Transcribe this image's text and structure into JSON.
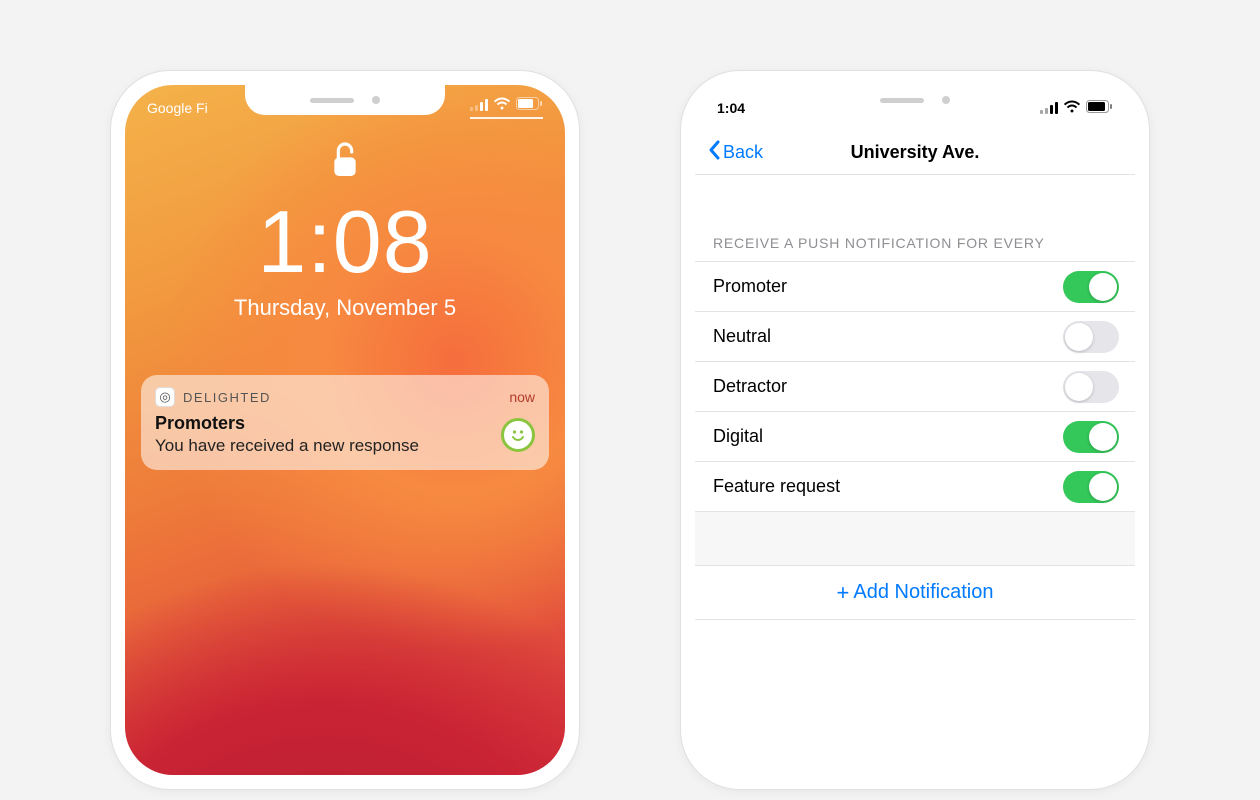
{
  "left": {
    "carrier": "Google Fi",
    "time": "1:08",
    "date": "Thursday, November 5",
    "notification": {
      "app": "DELIGHTED",
      "when": "now",
      "title": "Promoters",
      "message": "You have received a new response"
    }
  },
  "right": {
    "time": "1:04",
    "back_label": "Back",
    "title": "University Ave.",
    "section_header": "Receive a push notification for every",
    "toggles": [
      {
        "label": "Promoter",
        "on": true
      },
      {
        "label": "Neutral",
        "on": false
      },
      {
        "label": "Detractor",
        "on": false
      },
      {
        "label": "Digital",
        "on": true
      },
      {
        "label": "Feature request",
        "on": true
      }
    ],
    "add_label": "Add Notification"
  },
  "colors": {
    "ios_blue": "#007aff",
    "ios_green": "#34c759"
  }
}
